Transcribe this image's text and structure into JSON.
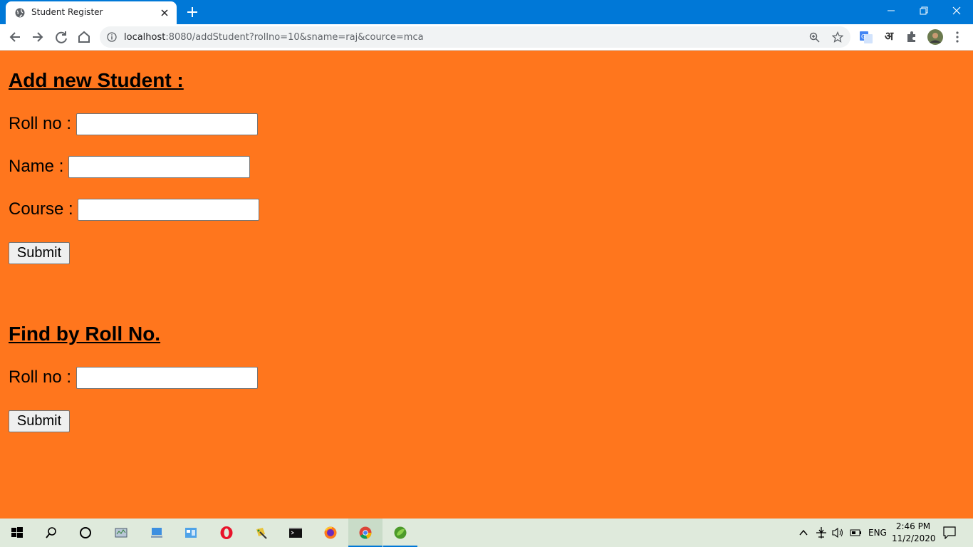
{
  "browser": {
    "tab_title": "Student Register",
    "url_host": "localhost",
    "url_rest": ":8080/addStudent?rollno=10&sname=raj&cource=mca",
    "extension_hindi": "अ"
  },
  "add_form": {
    "heading": "Add new Student :",
    "rollno_label": "Roll no :",
    "rollno_value": "",
    "name_label": "Name :",
    "name_value": "",
    "course_label": "Course :",
    "course_value": "",
    "submit_label": "Submit"
  },
  "find_form": {
    "heading": "Find by Roll No.",
    "rollno_label": "Roll no :",
    "rollno_value": "",
    "submit_label": "Submit"
  },
  "taskbar": {
    "language": "ENG",
    "time": "2:46 PM",
    "date": "11/2/2020",
    "apps": [
      "start-icon",
      "search-icon",
      "cortana-icon",
      "task-manager-icon",
      "computer-icon",
      "control-panel-icon",
      "opera-icon",
      "paint-icon",
      "terminal-icon",
      "firefox-icon",
      "chrome-icon",
      "spring-tool-icon"
    ]
  },
  "colors": {
    "page_background": "#ff761d",
    "titlebar": "#0078d7",
    "taskbar": "#dfeadc"
  }
}
